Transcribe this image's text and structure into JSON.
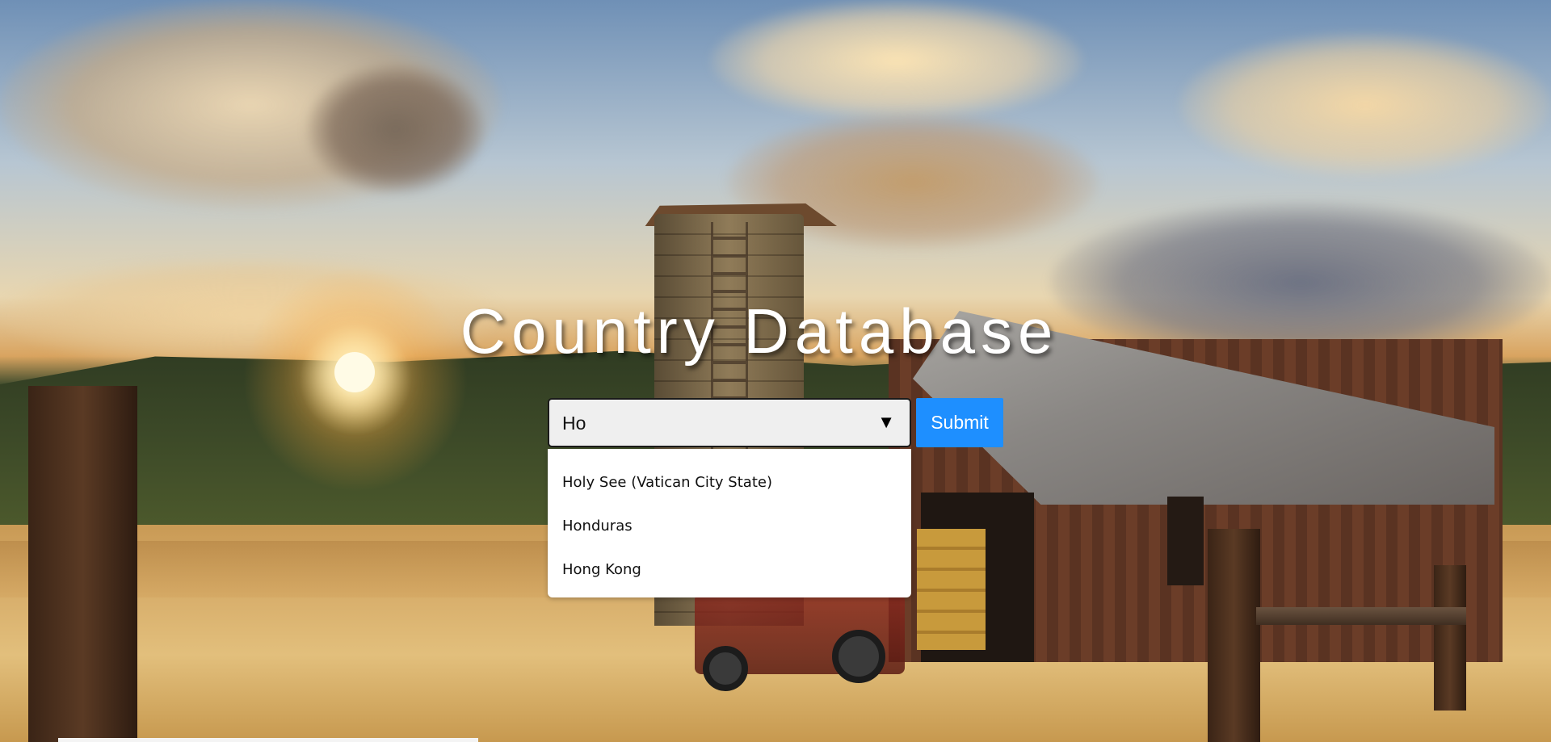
{
  "page": {
    "title": "Country Database"
  },
  "search": {
    "value": "Ho",
    "arrow_icon": "triangle-down-icon"
  },
  "submit": {
    "label": "Submit",
    "color": "#1e8fff"
  },
  "dropdown": {
    "items": [
      {
        "label": "Holy See (Vatican City State)"
      },
      {
        "label": "Honduras"
      },
      {
        "label": "Hong Kong"
      }
    ]
  },
  "background": {
    "description_icon": "farm-sunset-background"
  }
}
